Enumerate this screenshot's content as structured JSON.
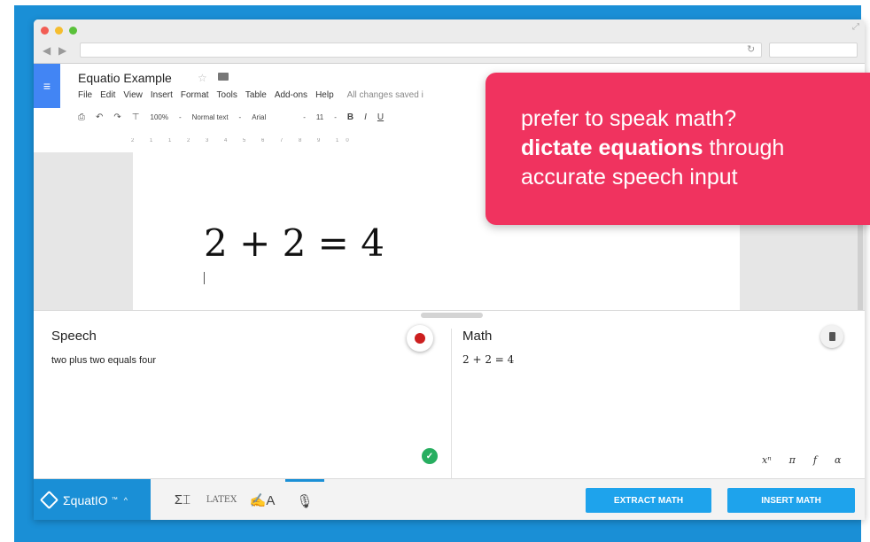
{
  "browser": {
    "doc_title": "Equatio Example",
    "menu": [
      "File",
      "Edit",
      "View",
      "Insert",
      "Format",
      "Tools",
      "Table",
      "Add-ons",
      "Help"
    ],
    "saved_status": "All changes saved i",
    "toolbar": {
      "zoom": "100%",
      "style": "Normal text",
      "font": "Arial",
      "size": "11",
      "bold": "B",
      "italic": "I",
      "underline": "U"
    },
    "ruler": "2 1 1 2 3 4 5 6 7 8 9 10"
  },
  "document": {
    "equation": "2 + 2 = 4"
  },
  "banner": {
    "line1": "prefer to speak math?",
    "line2_bold": "dictate equations",
    "line2_rest": " through",
    "line3": "accurate speech input"
  },
  "panel": {
    "speech_label": "Speech",
    "speech_text": "two plus two equals four",
    "math_label": "Math",
    "math_text": "2 + 2 = 4",
    "symbols": [
      "xⁿ",
      "π",
      "f",
      "α"
    ]
  },
  "bottombar": {
    "brand": "ƩquatIO",
    "brand_tm": "™",
    "caret": "^",
    "modes": {
      "sum": "Σ⌶",
      "latex": "LATEX",
      "handwriting": "✍A",
      "mic": "🎙"
    },
    "extract_label": "EXTRACT MATH",
    "insert_label": "INSERT MATH"
  },
  "colors": {
    "frame": "#1a8fd6",
    "banner": "#f0335f",
    "button": "#1ea3ec",
    "record": "#cc1f1f"
  }
}
